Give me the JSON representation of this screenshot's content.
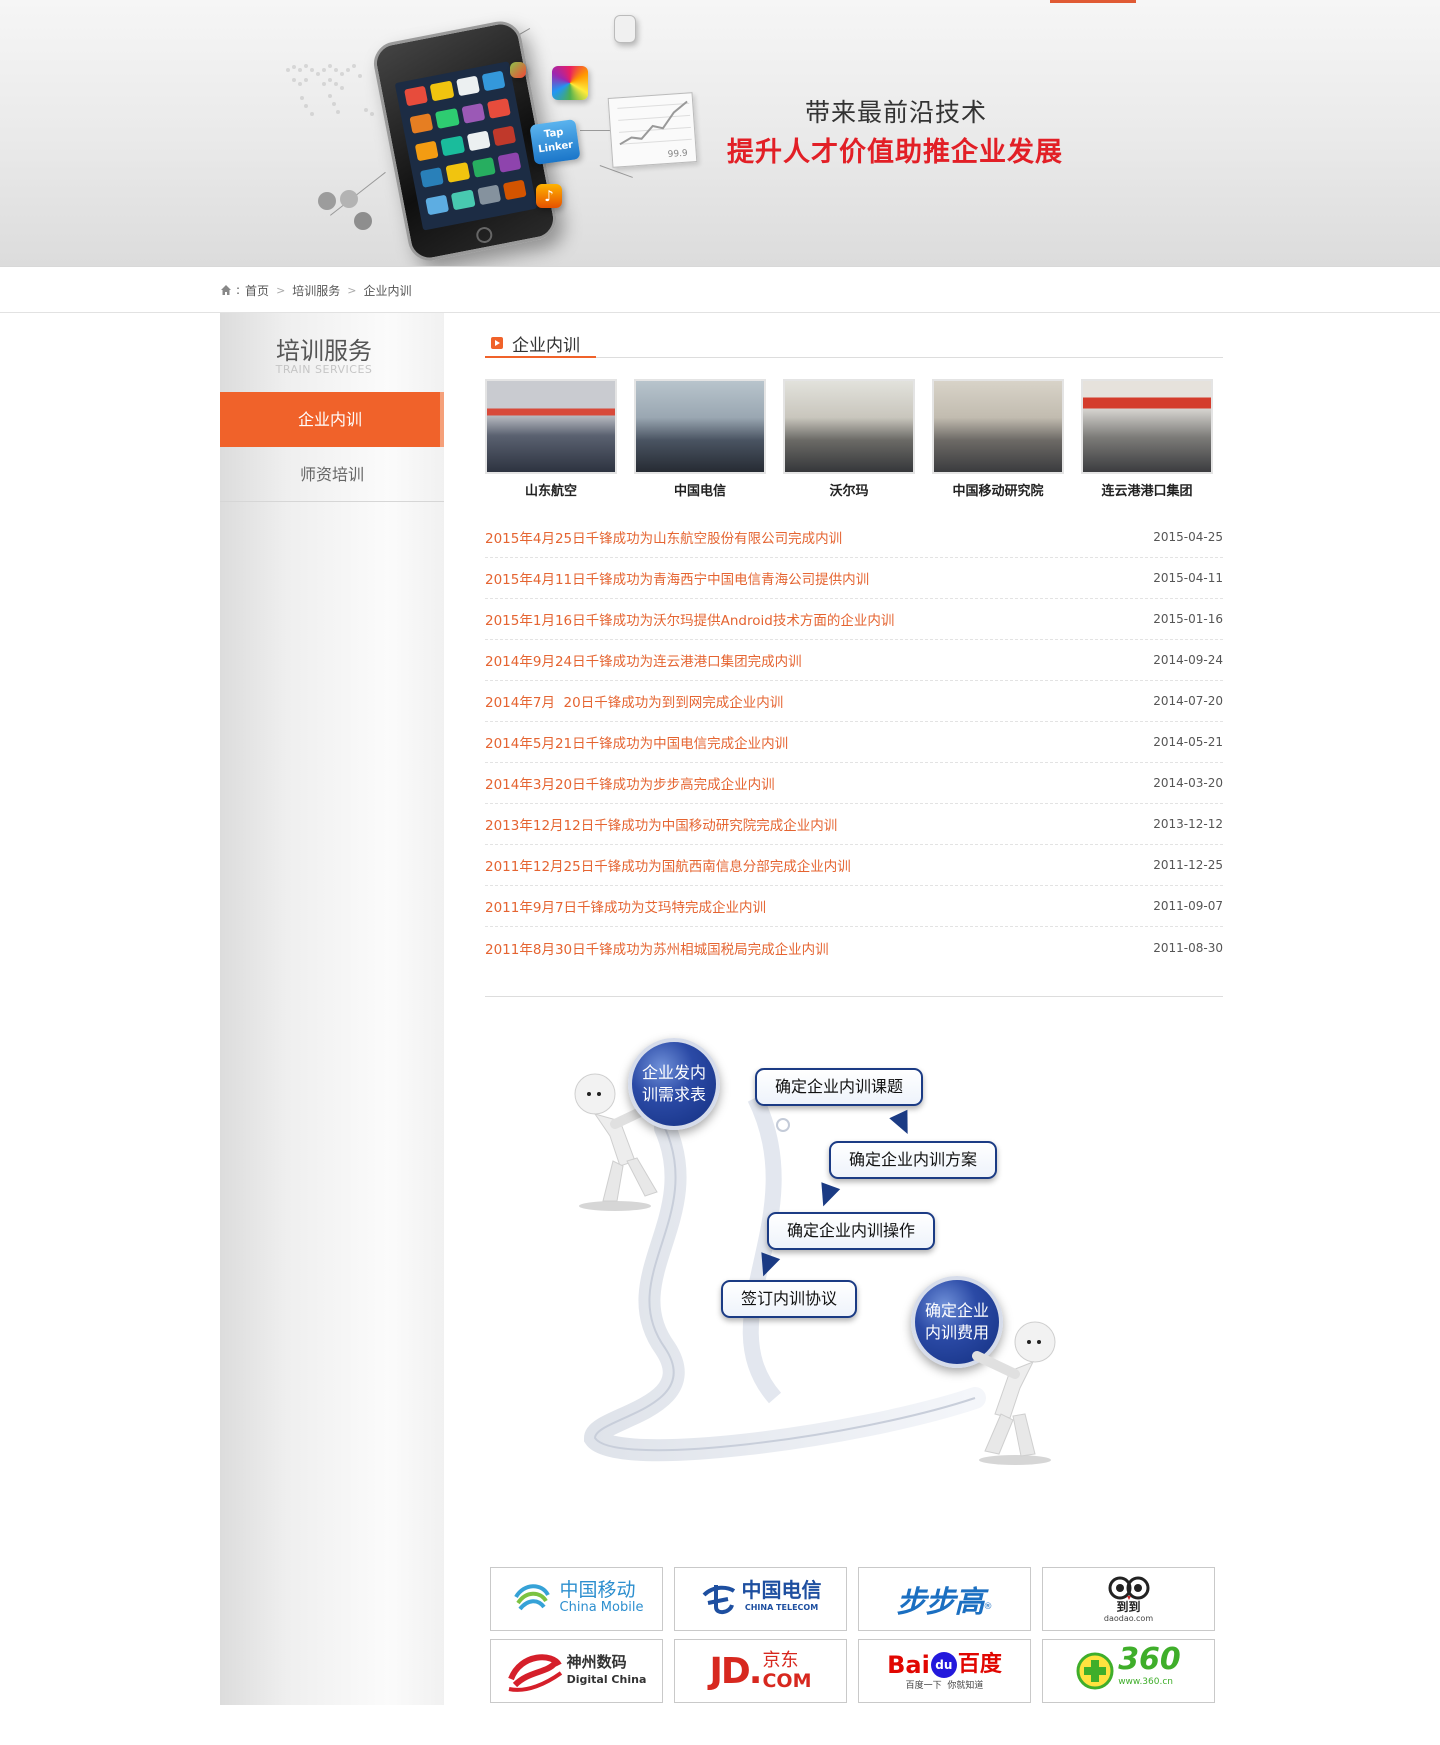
{
  "banner": {
    "line1": "带来最前沿技术",
    "line2": "提升人才价值助推企业发展",
    "tap_icon_text": "Tap Linker",
    "chart_card_value": "99.9"
  },
  "breadcrumb": {
    "sep": ":",
    "items": [
      "首页",
      "培训服务",
      "企业内训"
    ]
  },
  "sidebar": {
    "title": "培训服务",
    "subtitle": "TRAIN SERVICES",
    "items": [
      {
        "label": "企业内训",
        "active": true
      },
      {
        "label": "师资培训",
        "active": false
      }
    ]
  },
  "section": {
    "title": "企业内训"
  },
  "photos": [
    {
      "caption": "山东航空"
    },
    {
      "caption": "中国电信"
    },
    {
      "caption": "沃尔玛"
    },
    {
      "caption": "中国移动研究院"
    },
    {
      "caption": "连云港港口集团"
    }
  ],
  "news": [
    {
      "title": "2015年4月25日千锋成功为山东航空股份有限公司完成内训",
      "date": "2015-04-25"
    },
    {
      "title": "2015年4月11日千锋成功为青海西宁中国电信青海公司提供内训",
      "date": "2015-04-11"
    },
    {
      "title": "2015年1月16日千锋成功为沃尔玛提供Android技术方面的企业内训",
      "date": "2015-01-16"
    },
    {
      "title": "2014年9月24日千锋成功为连云港港口集团完成内训",
      "date": "2014-09-24"
    },
    {
      "title": "2014年7月  20日千锋成功为到到网完成企业内训",
      "date": "2014-07-20"
    },
    {
      "title": "2014年5月21日千锋成功为中国电信完成企业内训",
      "date": "2014-05-21"
    },
    {
      "title": "2014年3月20日千锋成功为步步高完成企业内训",
      "date": "2014-03-20"
    },
    {
      "title": "2013年12月12日千锋成功为中国移动研究院完成企业内训",
      "date": "2013-12-12"
    },
    {
      "title": "2011年12月25日千锋成功为国航西南信息分部完成企业内训",
      "date": "2011-12-25"
    },
    {
      "title": "2011年9月7日千锋成功为艾玛特完成企业内训",
      "date": "2011-09-07"
    },
    {
      "title": "2011年8月30日千锋成功为苏州相城国税局完成企业内训",
      "date": "2011-08-30"
    }
  ],
  "flow": {
    "start_ball_l1": "企业发内",
    "start_ball_l2": "训需求表",
    "step1": "确定企业内训课题",
    "step2": "确定企业内训方案",
    "step3": "确定企业内训操作",
    "step4": "签订内训协议",
    "end_ball_l1": "确定企业",
    "end_ball_l2": "内训费用"
  },
  "partners": {
    "china_mobile": {
      "cn": "中国移动",
      "en": "China Mobile"
    },
    "china_telecom": {
      "cn": "中国电信",
      "en": "CHINA TELECOM"
    },
    "bubugao": {
      "cn": "步步高"
    },
    "daodao": {
      "cn": "到到",
      "en": "daodao.com"
    },
    "digital_china": {
      "cn": "神州数码",
      "en": "Digital China"
    },
    "jd": {
      "mark": "JD.",
      "cn": "京东",
      "en": "COM"
    },
    "baidu": {
      "brand_a": "Bai",
      "brand_b": "du",
      "cn": "百度",
      "slogan": "百度一下  你就知道"
    },
    "qihoo": {
      "mark": "360",
      "en": "www.360.cn"
    }
  },
  "colors": {
    "accent": "#f0622a",
    "news_link": "#e56431",
    "banner_red": "#e21f26",
    "flow_blue": "#1b3b84"
  }
}
